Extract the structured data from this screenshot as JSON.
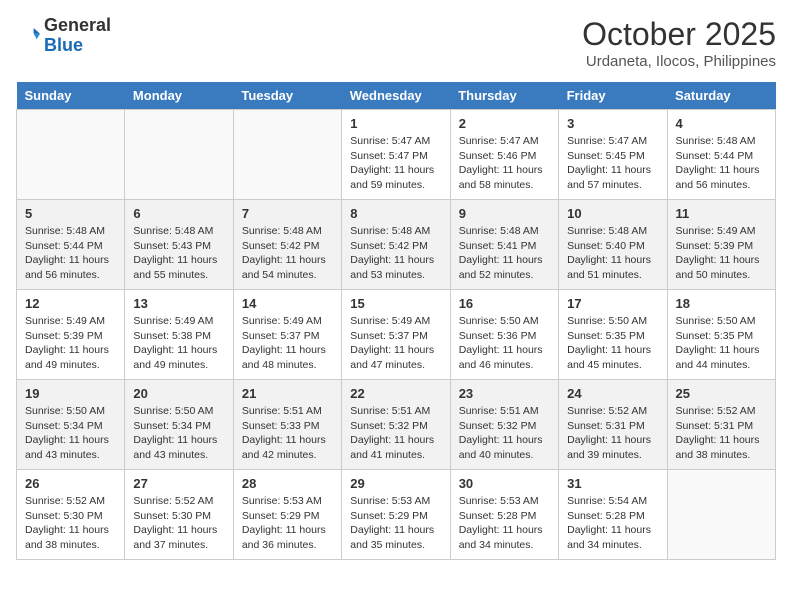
{
  "header": {
    "logo_general": "General",
    "logo_blue": "Blue",
    "month_title": "October 2025",
    "location": "Urdaneta, Ilocos, Philippines"
  },
  "days_of_week": [
    "Sunday",
    "Monday",
    "Tuesday",
    "Wednesday",
    "Thursday",
    "Friday",
    "Saturday"
  ],
  "weeks": [
    [
      {
        "day": "",
        "info": ""
      },
      {
        "day": "",
        "info": ""
      },
      {
        "day": "",
        "info": ""
      },
      {
        "day": "1",
        "info": "Sunrise: 5:47 AM\nSunset: 5:47 PM\nDaylight: 11 hours and 59 minutes."
      },
      {
        "day": "2",
        "info": "Sunrise: 5:47 AM\nSunset: 5:46 PM\nDaylight: 11 hours and 58 minutes."
      },
      {
        "day": "3",
        "info": "Sunrise: 5:47 AM\nSunset: 5:45 PM\nDaylight: 11 hours and 57 minutes."
      },
      {
        "day": "4",
        "info": "Sunrise: 5:48 AM\nSunset: 5:44 PM\nDaylight: 11 hours and 56 minutes."
      }
    ],
    [
      {
        "day": "5",
        "info": "Sunrise: 5:48 AM\nSunset: 5:44 PM\nDaylight: 11 hours and 56 minutes."
      },
      {
        "day": "6",
        "info": "Sunrise: 5:48 AM\nSunset: 5:43 PM\nDaylight: 11 hours and 55 minutes."
      },
      {
        "day": "7",
        "info": "Sunrise: 5:48 AM\nSunset: 5:42 PM\nDaylight: 11 hours and 54 minutes."
      },
      {
        "day": "8",
        "info": "Sunrise: 5:48 AM\nSunset: 5:42 PM\nDaylight: 11 hours and 53 minutes."
      },
      {
        "day": "9",
        "info": "Sunrise: 5:48 AM\nSunset: 5:41 PM\nDaylight: 11 hours and 52 minutes."
      },
      {
        "day": "10",
        "info": "Sunrise: 5:48 AM\nSunset: 5:40 PM\nDaylight: 11 hours and 51 minutes."
      },
      {
        "day": "11",
        "info": "Sunrise: 5:49 AM\nSunset: 5:39 PM\nDaylight: 11 hours and 50 minutes."
      }
    ],
    [
      {
        "day": "12",
        "info": "Sunrise: 5:49 AM\nSunset: 5:39 PM\nDaylight: 11 hours and 49 minutes."
      },
      {
        "day": "13",
        "info": "Sunrise: 5:49 AM\nSunset: 5:38 PM\nDaylight: 11 hours and 49 minutes."
      },
      {
        "day": "14",
        "info": "Sunrise: 5:49 AM\nSunset: 5:37 PM\nDaylight: 11 hours and 48 minutes."
      },
      {
        "day": "15",
        "info": "Sunrise: 5:49 AM\nSunset: 5:37 PM\nDaylight: 11 hours and 47 minutes."
      },
      {
        "day": "16",
        "info": "Sunrise: 5:50 AM\nSunset: 5:36 PM\nDaylight: 11 hours and 46 minutes."
      },
      {
        "day": "17",
        "info": "Sunrise: 5:50 AM\nSunset: 5:35 PM\nDaylight: 11 hours and 45 minutes."
      },
      {
        "day": "18",
        "info": "Sunrise: 5:50 AM\nSunset: 5:35 PM\nDaylight: 11 hours and 44 minutes."
      }
    ],
    [
      {
        "day": "19",
        "info": "Sunrise: 5:50 AM\nSunset: 5:34 PM\nDaylight: 11 hours and 43 minutes."
      },
      {
        "day": "20",
        "info": "Sunrise: 5:50 AM\nSunset: 5:34 PM\nDaylight: 11 hours and 43 minutes."
      },
      {
        "day": "21",
        "info": "Sunrise: 5:51 AM\nSunset: 5:33 PM\nDaylight: 11 hours and 42 minutes."
      },
      {
        "day": "22",
        "info": "Sunrise: 5:51 AM\nSunset: 5:32 PM\nDaylight: 11 hours and 41 minutes."
      },
      {
        "day": "23",
        "info": "Sunrise: 5:51 AM\nSunset: 5:32 PM\nDaylight: 11 hours and 40 minutes."
      },
      {
        "day": "24",
        "info": "Sunrise: 5:52 AM\nSunset: 5:31 PM\nDaylight: 11 hours and 39 minutes."
      },
      {
        "day": "25",
        "info": "Sunrise: 5:52 AM\nSunset: 5:31 PM\nDaylight: 11 hours and 38 minutes."
      }
    ],
    [
      {
        "day": "26",
        "info": "Sunrise: 5:52 AM\nSunset: 5:30 PM\nDaylight: 11 hours and 38 minutes."
      },
      {
        "day": "27",
        "info": "Sunrise: 5:52 AM\nSunset: 5:30 PM\nDaylight: 11 hours and 37 minutes."
      },
      {
        "day": "28",
        "info": "Sunrise: 5:53 AM\nSunset: 5:29 PM\nDaylight: 11 hours and 36 minutes."
      },
      {
        "day": "29",
        "info": "Sunrise: 5:53 AM\nSunset: 5:29 PM\nDaylight: 11 hours and 35 minutes."
      },
      {
        "day": "30",
        "info": "Sunrise: 5:53 AM\nSunset: 5:28 PM\nDaylight: 11 hours and 34 minutes."
      },
      {
        "day": "31",
        "info": "Sunrise: 5:54 AM\nSunset: 5:28 PM\nDaylight: 11 hours and 34 minutes."
      },
      {
        "day": "",
        "info": ""
      }
    ]
  ]
}
